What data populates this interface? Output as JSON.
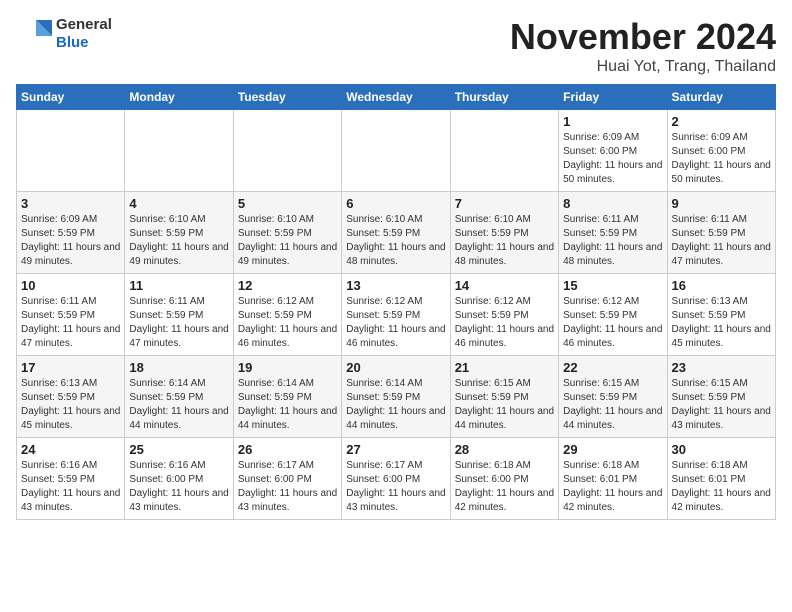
{
  "header": {
    "logo_general": "General",
    "logo_blue": "Blue",
    "month_title": "November 2024",
    "location": "Huai Yot, Trang, Thailand"
  },
  "days_of_week": [
    "Sunday",
    "Monday",
    "Tuesday",
    "Wednesday",
    "Thursday",
    "Friday",
    "Saturday"
  ],
  "weeks": [
    [
      {
        "day": "",
        "info": ""
      },
      {
        "day": "",
        "info": ""
      },
      {
        "day": "",
        "info": ""
      },
      {
        "day": "",
        "info": ""
      },
      {
        "day": "",
        "info": ""
      },
      {
        "day": "1",
        "info": "Sunrise: 6:09 AM\nSunset: 6:00 PM\nDaylight: 11 hours and 50 minutes."
      },
      {
        "day": "2",
        "info": "Sunrise: 6:09 AM\nSunset: 6:00 PM\nDaylight: 11 hours and 50 minutes."
      }
    ],
    [
      {
        "day": "3",
        "info": "Sunrise: 6:09 AM\nSunset: 5:59 PM\nDaylight: 11 hours and 49 minutes."
      },
      {
        "day": "4",
        "info": "Sunrise: 6:10 AM\nSunset: 5:59 PM\nDaylight: 11 hours and 49 minutes."
      },
      {
        "day": "5",
        "info": "Sunrise: 6:10 AM\nSunset: 5:59 PM\nDaylight: 11 hours and 49 minutes."
      },
      {
        "day": "6",
        "info": "Sunrise: 6:10 AM\nSunset: 5:59 PM\nDaylight: 11 hours and 48 minutes."
      },
      {
        "day": "7",
        "info": "Sunrise: 6:10 AM\nSunset: 5:59 PM\nDaylight: 11 hours and 48 minutes."
      },
      {
        "day": "8",
        "info": "Sunrise: 6:11 AM\nSunset: 5:59 PM\nDaylight: 11 hours and 48 minutes."
      },
      {
        "day": "9",
        "info": "Sunrise: 6:11 AM\nSunset: 5:59 PM\nDaylight: 11 hours and 47 minutes."
      }
    ],
    [
      {
        "day": "10",
        "info": "Sunrise: 6:11 AM\nSunset: 5:59 PM\nDaylight: 11 hours and 47 minutes."
      },
      {
        "day": "11",
        "info": "Sunrise: 6:11 AM\nSunset: 5:59 PM\nDaylight: 11 hours and 47 minutes."
      },
      {
        "day": "12",
        "info": "Sunrise: 6:12 AM\nSunset: 5:59 PM\nDaylight: 11 hours and 46 minutes."
      },
      {
        "day": "13",
        "info": "Sunrise: 6:12 AM\nSunset: 5:59 PM\nDaylight: 11 hours and 46 minutes."
      },
      {
        "day": "14",
        "info": "Sunrise: 6:12 AM\nSunset: 5:59 PM\nDaylight: 11 hours and 46 minutes."
      },
      {
        "day": "15",
        "info": "Sunrise: 6:12 AM\nSunset: 5:59 PM\nDaylight: 11 hours and 46 minutes."
      },
      {
        "day": "16",
        "info": "Sunrise: 6:13 AM\nSunset: 5:59 PM\nDaylight: 11 hours and 45 minutes."
      }
    ],
    [
      {
        "day": "17",
        "info": "Sunrise: 6:13 AM\nSunset: 5:59 PM\nDaylight: 11 hours and 45 minutes."
      },
      {
        "day": "18",
        "info": "Sunrise: 6:14 AM\nSunset: 5:59 PM\nDaylight: 11 hours and 44 minutes."
      },
      {
        "day": "19",
        "info": "Sunrise: 6:14 AM\nSunset: 5:59 PM\nDaylight: 11 hours and 44 minutes."
      },
      {
        "day": "20",
        "info": "Sunrise: 6:14 AM\nSunset: 5:59 PM\nDaylight: 11 hours and 44 minutes."
      },
      {
        "day": "21",
        "info": "Sunrise: 6:15 AM\nSunset: 5:59 PM\nDaylight: 11 hours and 44 minutes."
      },
      {
        "day": "22",
        "info": "Sunrise: 6:15 AM\nSunset: 5:59 PM\nDaylight: 11 hours and 44 minutes."
      },
      {
        "day": "23",
        "info": "Sunrise: 6:15 AM\nSunset: 5:59 PM\nDaylight: 11 hours and 43 minutes."
      }
    ],
    [
      {
        "day": "24",
        "info": "Sunrise: 6:16 AM\nSunset: 5:59 PM\nDaylight: 11 hours and 43 minutes."
      },
      {
        "day": "25",
        "info": "Sunrise: 6:16 AM\nSunset: 6:00 PM\nDaylight: 11 hours and 43 minutes."
      },
      {
        "day": "26",
        "info": "Sunrise: 6:17 AM\nSunset: 6:00 PM\nDaylight: 11 hours and 43 minutes."
      },
      {
        "day": "27",
        "info": "Sunrise: 6:17 AM\nSunset: 6:00 PM\nDaylight: 11 hours and 43 minutes."
      },
      {
        "day": "28",
        "info": "Sunrise: 6:18 AM\nSunset: 6:00 PM\nDaylight: 11 hours and 42 minutes."
      },
      {
        "day": "29",
        "info": "Sunrise: 6:18 AM\nSunset: 6:01 PM\nDaylight: 11 hours and 42 minutes."
      },
      {
        "day": "30",
        "info": "Sunrise: 6:18 AM\nSunset: 6:01 PM\nDaylight: 11 hours and 42 minutes."
      }
    ]
  ]
}
